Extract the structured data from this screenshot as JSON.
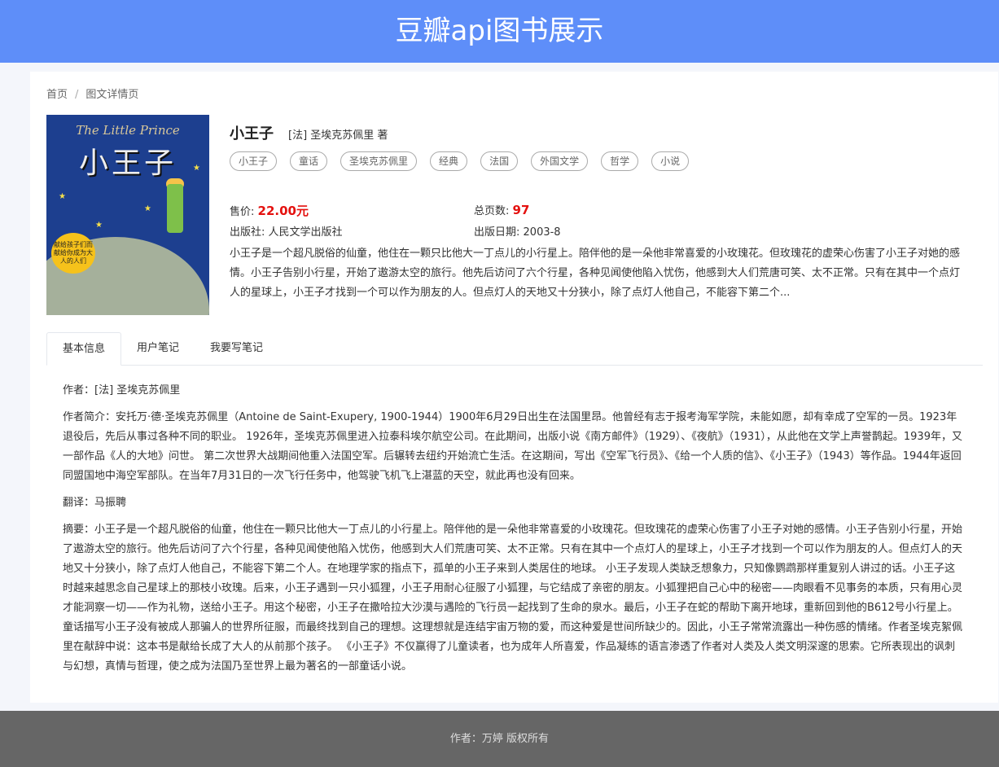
{
  "header": {
    "title": "豆瓣api图书展示"
  },
  "breadcrumb": {
    "home": "首页",
    "separator": "/",
    "current": "图文详情页"
  },
  "cover": {
    "title_en": "The Little Prince",
    "title_cn": "小王子",
    "badge": "献给孩子们而献给你成为大人的人们"
  },
  "book": {
    "title": "小王子",
    "author": "[法] 圣埃克苏佩里  著",
    "tags": [
      "小王子",
      "童话",
      "圣埃克苏佩里",
      "经典",
      "法国",
      "外国文学",
      "哲学",
      "小说"
    ],
    "price_label": "售价:",
    "price": "22.00元",
    "pages_label": "总页数:",
    "pages": "97",
    "publisher_label": "出版社:",
    "publisher": "人民文学出版社",
    "pubdate_label": "出版日期:",
    "pubdate": "2003-8",
    "summary_short": "小王子是一个超凡脱俗的仙童，他住在一颗只比他大一丁点儿的小行星上。陪伴他的是一朵他非常喜爱的小玫瑰花。但玫瑰花的虚荣心伤害了小王子对她的感情。小王子告别小行星，开始了遨游太空的旅行。他先后访问了六个行星，各种见闻使他陷入忧伤，他感到大人们荒唐可笑、太不正常。只有在其中一个点灯人的星球上，小王子才找到一个可以作为朋友的人。但点灯人的天地又十分狭小，除了点灯人他自己，不能容下第二个..."
  },
  "tabs": [
    "基本信息",
    "用户笔记",
    "我要写笔记"
  ],
  "details": {
    "author": "作者：[法] 圣埃克苏佩里",
    "author_intro": "作者简介：安托万·德·圣埃克苏佩里（Antoine de Saint-Exupery, 1900-1944）1900年6月29日出生在法国里昂。他曾经有志于报考海军学院，未能如愿，却有幸成了空军的一员。1923年退役后，先后从事过各种不同的职业。 1926年，圣埃克苏佩里进入拉泰科埃尔航空公司。在此期间，出版小说《南方邮件》（1929）、《夜航》（1931），从此他在文学上声誉鹊起。1939年，又一部作品《人的大地》问世。 第二次世界大战期间他重入法国空军。后辗转去纽约开始流亡生活。在这期间，写出《空军飞行员》、《给一个人质的信》、《小王子》（1943）等作品。1944年返回同盟国地中海空军部队。在当年7月31日的一次飞行任务中，他驾驶飞机飞上湛蓝的天空，就此再也没有回来。",
    "translator": "翻译：马振聘",
    "summary": "摘要：小王子是一个超凡脱俗的仙童，他住在一颗只比他大一丁点儿的小行星上。陪伴他的是一朵他非常喜爱的小玫瑰花。但玫瑰花的虚荣心伤害了小王子对她的感情。小王子告别小行星，开始了遨游太空的旅行。他先后访问了六个行星，各种见闻使他陷入忧伤，他感到大人们荒唐可笑、太不正常。只有在其中一个点灯人的星球上，小王子才找到一个可以作为朋友的人。但点灯人的天地又十分狭小，除了点灯人他自己，不能容下第二个人。在地理学家的指点下，孤单的小王子来到人类居住的地球。 小王子发现人类缺乏想象力，只知像鹦鹉那样重复别人讲过的话。小王子这时越来越思念自己星球上的那枝小玫瑰。后来，小王子遇到一只小狐狸，小王子用耐心征服了小狐狸，与它结成了亲密的朋友。小狐狸把自己心中的秘密——肉眼看不见事务的本质，只有用心灵才能洞察一切——作为礼物，送给小王子。用这个秘密，小王子在撒哈拉大沙漠与遇险的飞行员一起找到了生命的泉水。最后，小王子在蛇的帮助下离开地球，重新回到他的B612号小行星上。 童话描写小王子没有被成人那骗人的世界所征服，而最终找到自己的理想。这理想就是连结宇宙万物的爱，而这种爱是世间所缺少的。因此，小王子常常流露出一种伤感的情绪。作者圣埃克絮佩里在献辞中说：这本书是献给长成了大人的从前那个孩子。 《小王子》不仅赢得了儿童读者，也为成年人所喜爱，作品凝练的语言渗透了作者对人类及人类文明深邃的思索。它所表现出的讽刺与幻想，真情与哲理，使之成为法国乃至世界上最为著名的一部童话小说。"
  },
  "footer": {
    "text": "作者：万婷 版权所有"
  }
}
